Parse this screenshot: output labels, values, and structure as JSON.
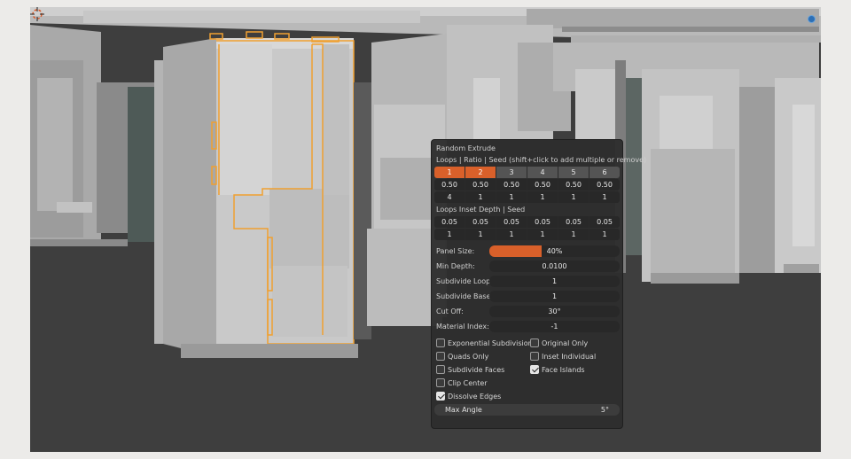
{
  "panel": {
    "title": "Random Extrude",
    "loops_header": "Loops | Ratio | Seed   (shift+click to add multiple or remove)",
    "loops": [
      "1",
      "2",
      "3",
      "4",
      "5",
      "6"
    ],
    "ratios": [
      "0.50",
      "0.50",
      "0.50",
      "0.50",
      "0.50",
      "0.50"
    ],
    "seeds": [
      "4",
      "1",
      "1",
      "1",
      "1",
      "1"
    ],
    "inset_header": "Loops Inset Depth | Seed",
    "inset_depths": [
      "0.05",
      "0.05",
      "0.05",
      "0.05",
      "0.05",
      "0.05"
    ],
    "inset_seeds": [
      "1",
      "1",
      "1",
      "1",
      "1",
      "1"
    ],
    "panel_size_label": "Panel Size:",
    "panel_size_value": "40%",
    "panel_size_fraction": 0.4,
    "min_depth_label": "Min Depth:",
    "min_depth_value": "0.0100",
    "subdivide_loop_label": "Subdivide Loop:",
    "subdivide_loop_value": "1",
    "subdivide_base_label": "Subdivide Base:",
    "subdivide_base_value": "1",
    "cut_off_label": "Cut Off:",
    "cut_off_value": "30°",
    "material_index_label": "Material Index:",
    "material_index_value": "-1",
    "checkboxes": {
      "exponential_subdivision": "Exponential Subdivision",
      "original_only": "Original Only",
      "quads_only": "Quads Only",
      "inset_individual": "Inset Individual",
      "subdivide_faces": "Subdivide Faces",
      "face_islands": "Face Islands",
      "clip_center": "Clip Center",
      "dissolve_edges": "Dissolve Edges"
    },
    "max_angle_label": "Max Angle",
    "max_angle_value": "5°"
  },
  "colors": {
    "accent": "#d9602a",
    "selection_outline": "#f0a030",
    "viewport_bg": "#3f3f3f"
  }
}
